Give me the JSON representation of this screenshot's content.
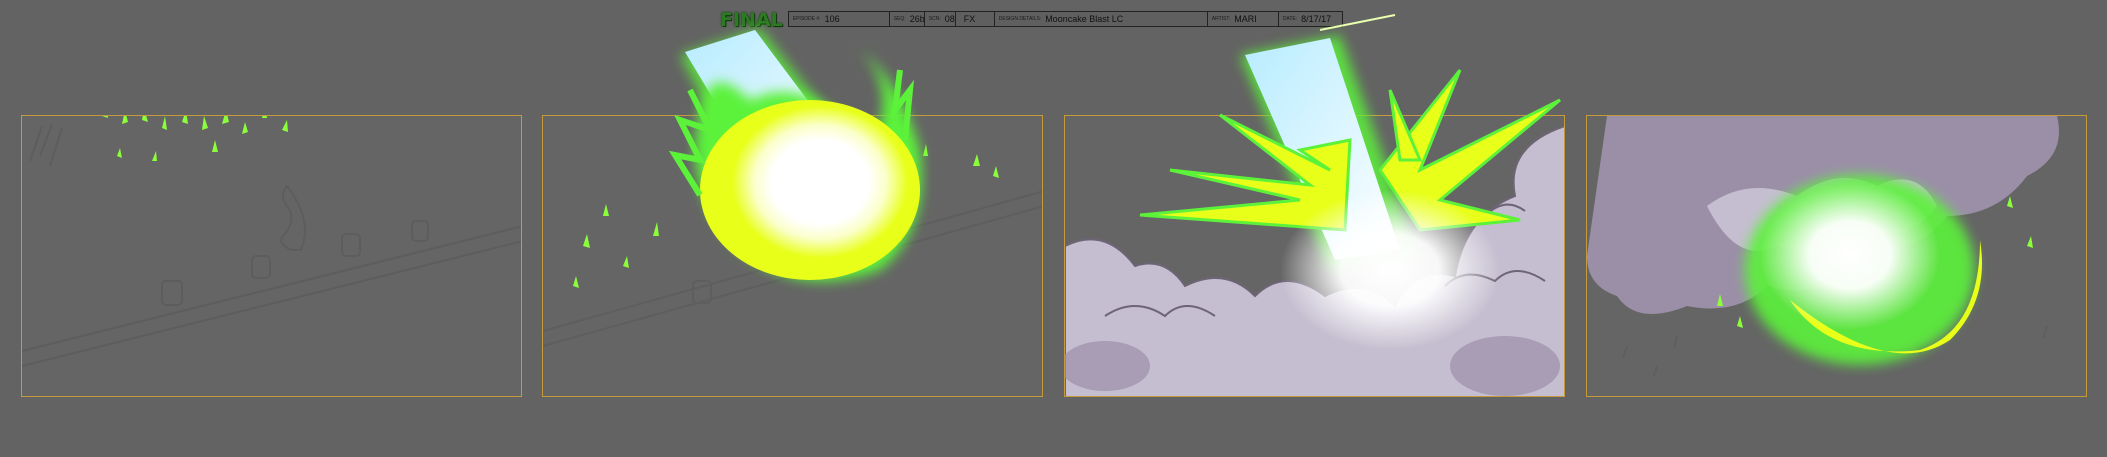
{
  "header": {
    "logo_text": "FINAL",
    "fields": [
      {
        "label": "EPISODE #:",
        "value": "106"
      },
      {
        "label": "SEQ:",
        "value": "26b"
      },
      {
        "label": "SCN:",
        "value": "08"
      },
      {
        "label": "",
        "value": "FX"
      },
      {
        "label": "DESIGN DETAILS:",
        "value": "Mooncake Blast LC"
      },
      {
        "label": "ARTIST:",
        "value": "MARI"
      },
      {
        "label": "DATE:",
        "value": "8/17/17"
      }
    ]
  },
  "panels": [
    {
      "name": "panel-1",
      "content": "green sparks over faint rough sketch"
    },
    {
      "name": "panel-2",
      "content": "glowing green energy ball with light beam"
    },
    {
      "name": "panel-3",
      "content": "impact burst with smoke clouds"
    },
    {
      "name": "panel-4",
      "content": "fading energy ball in smoke"
    }
  ],
  "colors": {
    "background": "#636363",
    "panel_border": "#c49a3c",
    "energy_green": "#5cf23a",
    "energy_yellow": "#e8ff1a",
    "beam": "#c8f4ff",
    "smoke": "#c5bed0",
    "smoke_shadow": "#9b8fa8"
  }
}
